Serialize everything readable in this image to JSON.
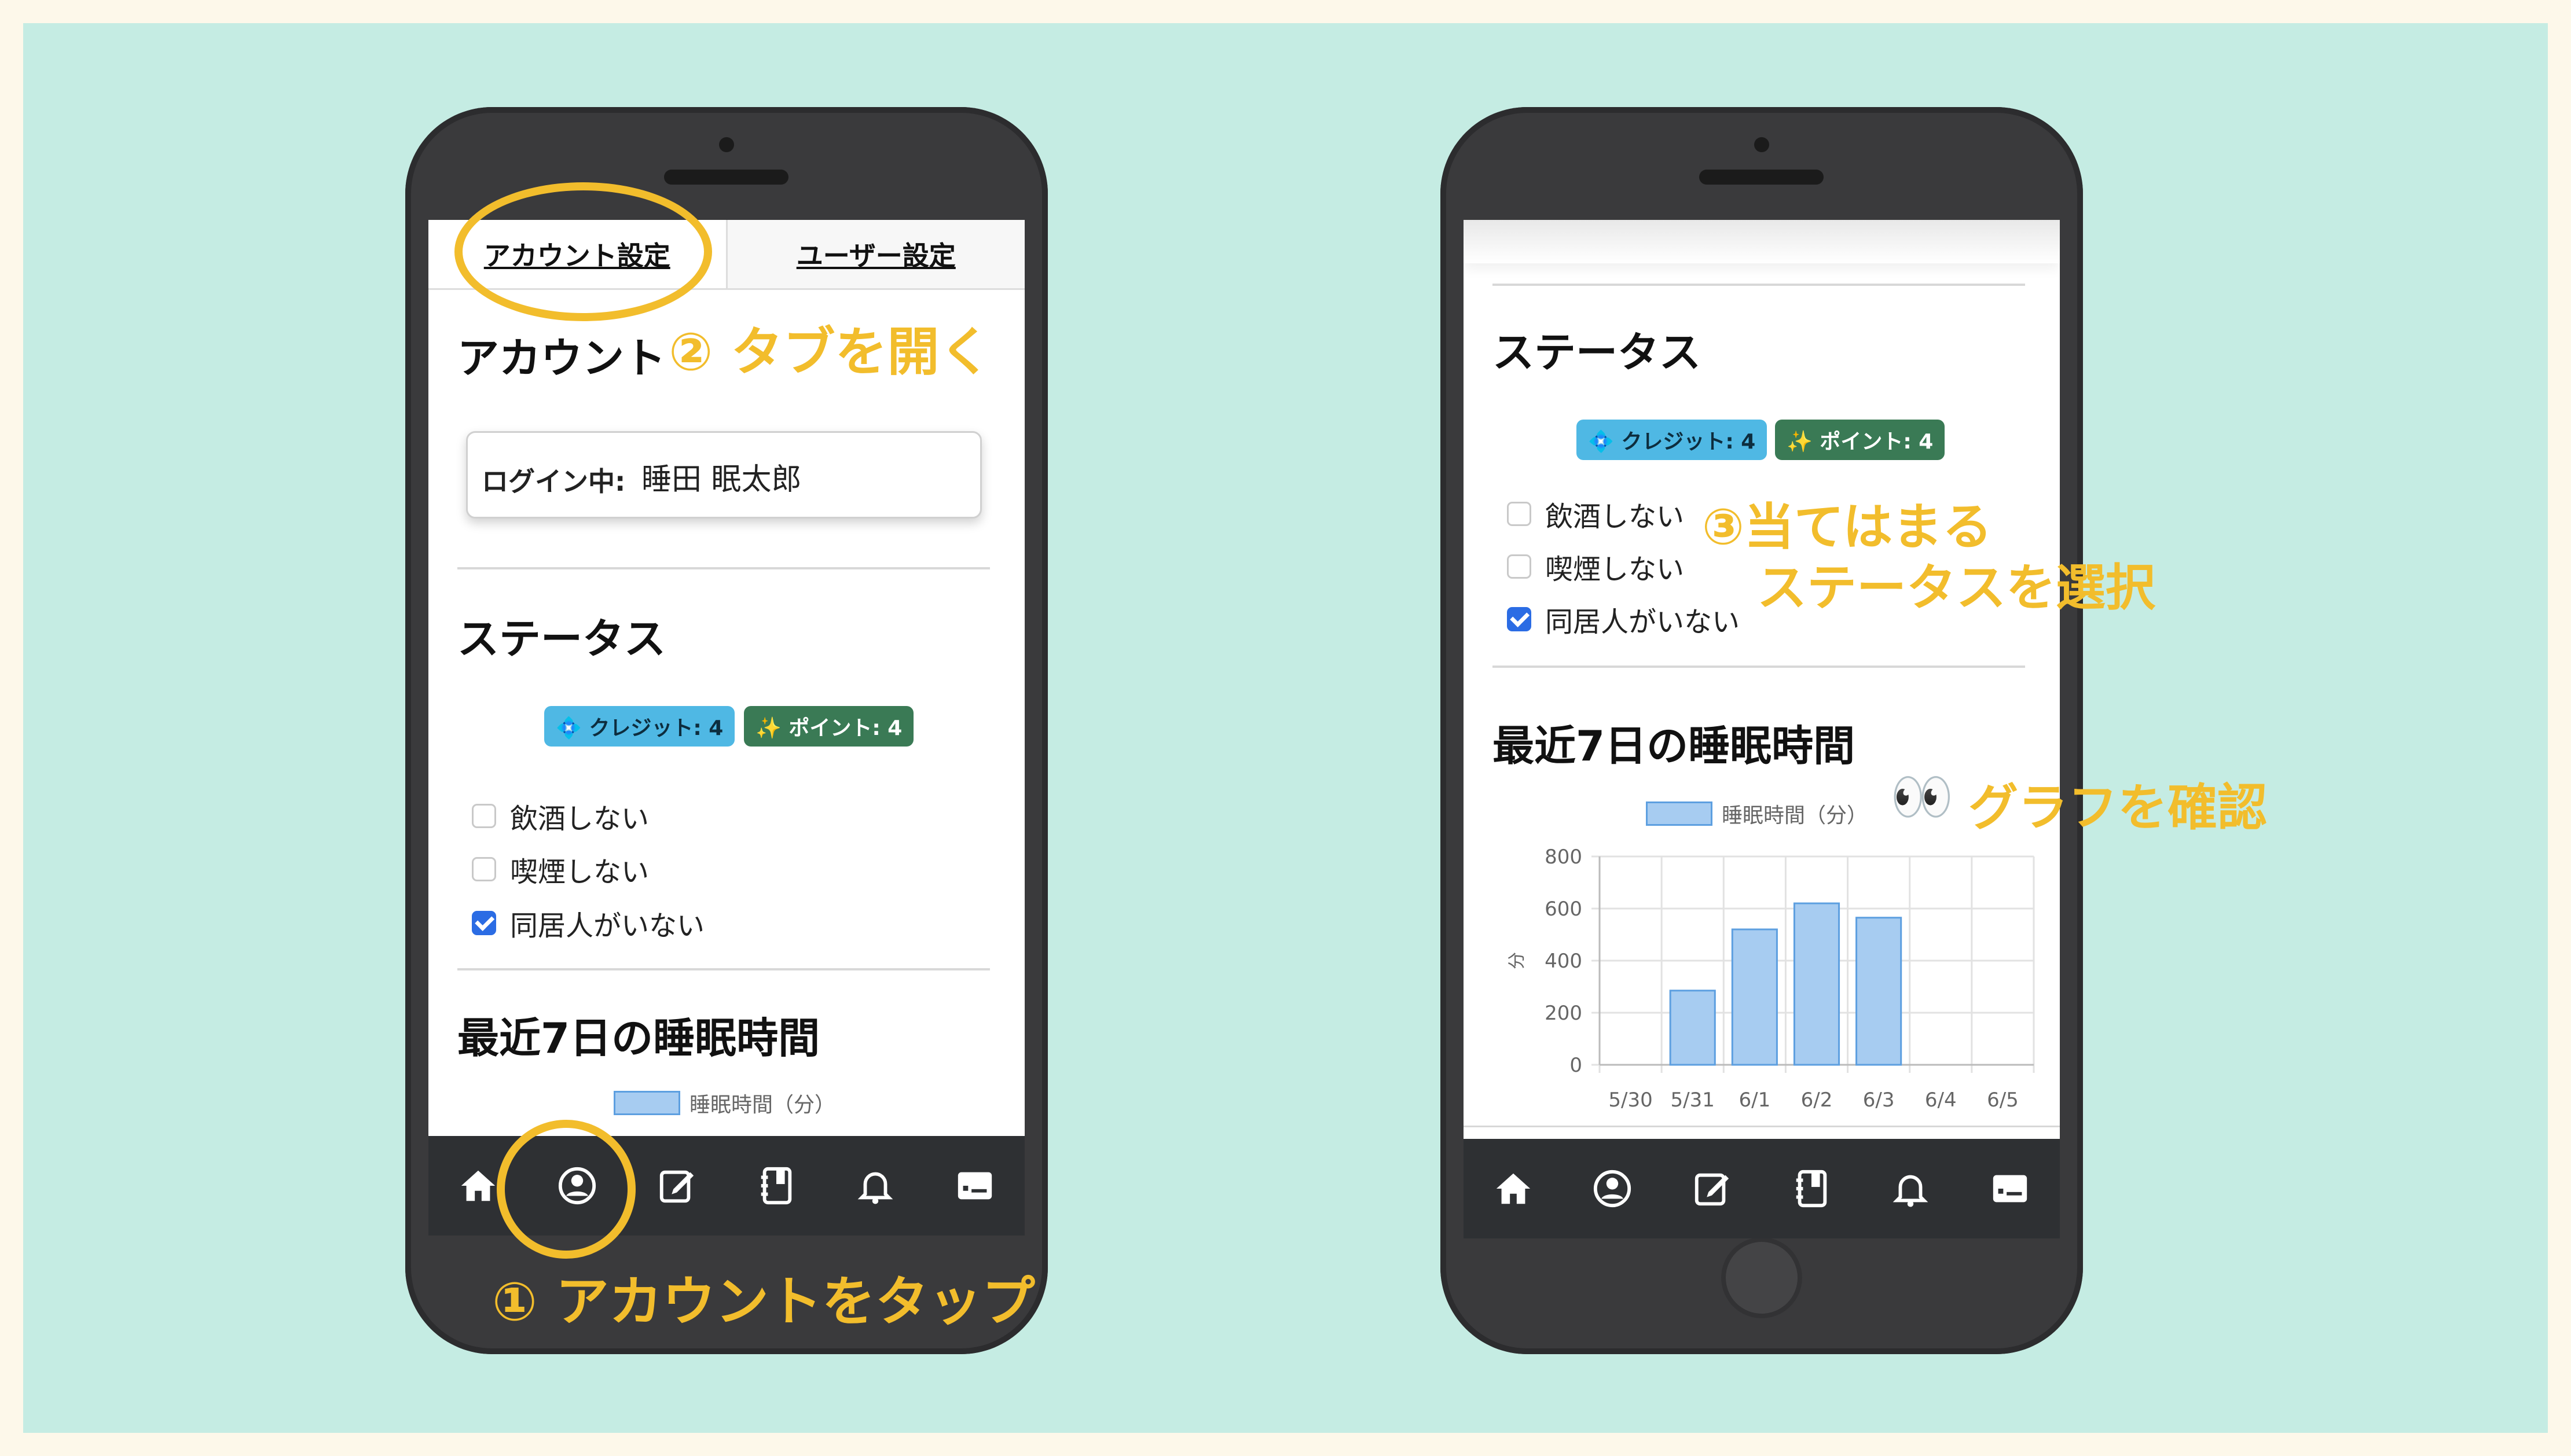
{
  "accent_color": "#f2bd2c",
  "left_screen": {
    "tabs": [
      "アカウント設定",
      "ユーザー設定"
    ],
    "account_heading": "アカウント",
    "login_label": "ログイン中:",
    "login_name": "睡田 眠太郎",
    "status_heading": "ステータス",
    "badge_credit": "💠 クレジット: 4",
    "badge_point": "✨ ポイント: 4",
    "checkboxes": [
      {
        "label": "飲酒しない",
        "checked": false
      },
      {
        "label": "喫煙しない",
        "checked": false
      },
      {
        "label": "同居人がいない",
        "checked": true
      }
    ],
    "sleep_heading": "最近7日の睡眠時間",
    "legend_label": "睡眠時間（分）"
  },
  "right_screen": {
    "status_heading": "ステータス",
    "badge_credit": "💠 クレジット: 4",
    "badge_point": "✨ ポイント: 4",
    "checkboxes": [
      {
        "label": "飲酒しない",
        "checked": false
      },
      {
        "label": "喫煙しない",
        "checked": false
      },
      {
        "label": "同居人がいない",
        "checked": true
      }
    ],
    "sleep_heading": "最近7日の睡眠時間",
    "legend_label": "睡眠時間（分）"
  },
  "nav_icons": [
    "home-icon",
    "account-icon",
    "edit-icon",
    "notebook-icon",
    "bell-icon",
    "dashboard-icon"
  ],
  "annotations": {
    "step1": "① アカウントをタップ",
    "step2": "② タブを開く",
    "step3_line1": "③当てはまる",
    "step3_line2": "ステータスを選択",
    "step4_emoji": "👀",
    "step4": "グラフを確認"
  },
  "chart_data": {
    "type": "bar",
    "categories": [
      "5/30",
      "5/31",
      "6/1",
      "6/2",
      "6/3",
      "6/4",
      "6/5"
    ],
    "series": [
      {
        "name": "睡眠時間（分）",
        "values": [
          0,
          285,
          520,
          620,
          565,
          0,
          0
        ]
      }
    ],
    "ylabel": "分",
    "ylim": [
      0,
      800
    ],
    "yticks": [
      0,
      200,
      400,
      600,
      800
    ],
    "grid": true,
    "legend_position": "top"
  }
}
